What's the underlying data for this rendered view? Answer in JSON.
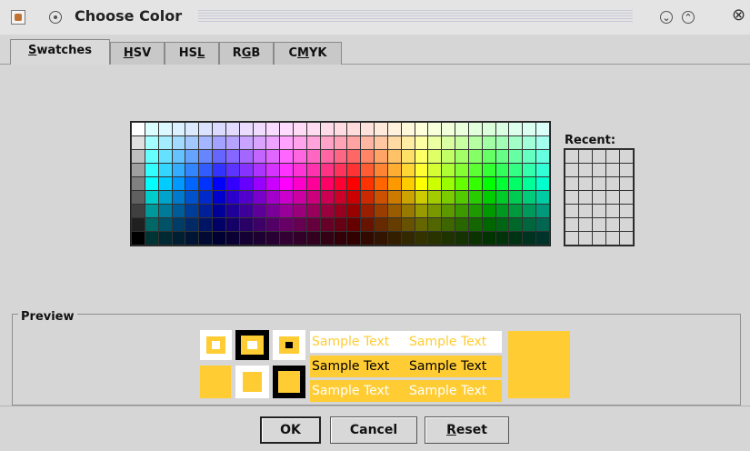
{
  "window": {
    "title": "Choose Color"
  },
  "tabs": [
    {
      "label": "Swatches",
      "mnemonic": "S",
      "rest": "watches",
      "active": true
    },
    {
      "label": "HSV",
      "mnemonic": "H",
      "rest": "SV",
      "active": false
    },
    {
      "label": "HSL",
      "mnemonic": "L",
      "pre": "HS",
      "active": false
    },
    {
      "label": "RGB",
      "mnemonic": "G",
      "pre": "R",
      "post": "B",
      "active": false
    },
    {
      "label": "CMYK",
      "mnemonic": "M",
      "pre": "C",
      "post": "YK",
      "active": false
    }
  ],
  "swatches": {
    "columns": 31,
    "rows": 9
  },
  "recent": {
    "label": "Recent:",
    "columns": 5,
    "rows": 7
  },
  "preview": {
    "label": "Preview",
    "selected_color": "#ffcc33",
    "sample_text": "Sample Text",
    "rows": [
      {
        "fg": "#ffcc33",
        "bg": "#ffffff"
      },
      {
        "fg": "#000000",
        "bg": "#ffcc33"
      },
      {
        "fg": "#ffffff",
        "bg": "#ffcc33"
      }
    ]
  },
  "buttons": {
    "ok": {
      "label": "OK",
      "default": true
    },
    "cancel": {
      "label": "Cancel"
    },
    "reset": {
      "label": "Reset",
      "mnemonic": "R",
      "rest": "eset"
    }
  },
  "colors": {
    "accent": "#ffcc33",
    "background": "#d6d6d6"
  }
}
